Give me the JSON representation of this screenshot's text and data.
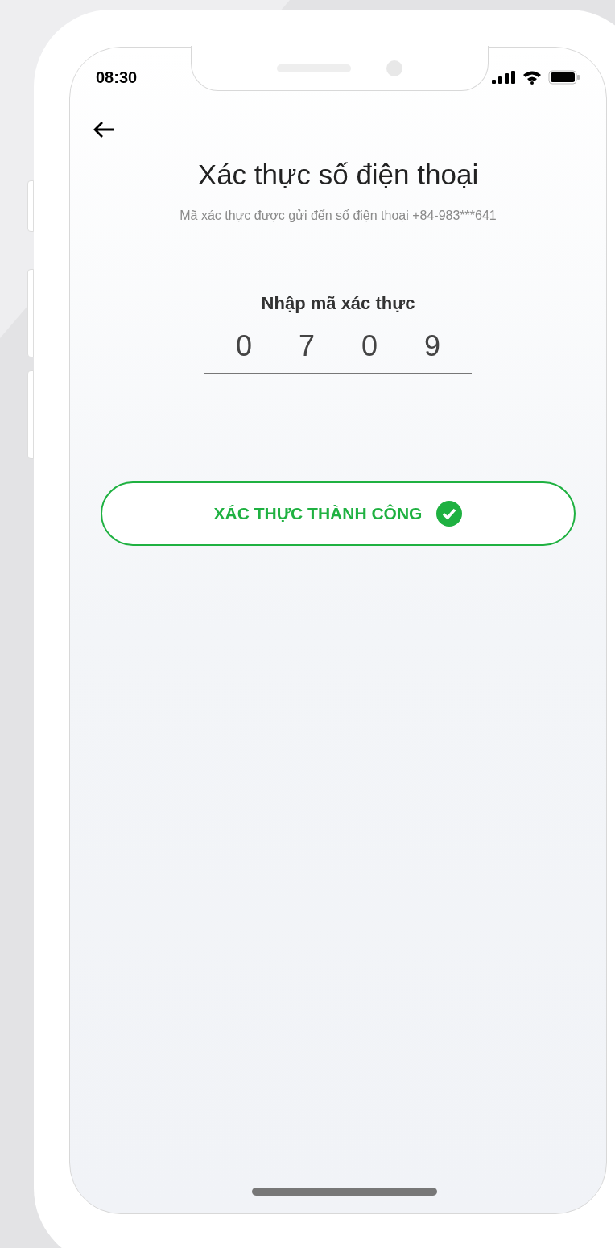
{
  "status_bar": {
    "time": "08:30"
  },
  "header": {
    "title": "Xác thực số điện thoại",
    "subtitle": "Mã xác thực được gửi đến số điện thoại +84-983***641"
  },
  "code_entry": {
    "label": "Nhập mã xác thực",
    "digits": [
      "0",
      "7",
      "0",
      "9"
    ]
  },
  "verify_button": {
    "label": "XÁC THỰC THÀNH CÔNG",
    "verified": true
  }
}
